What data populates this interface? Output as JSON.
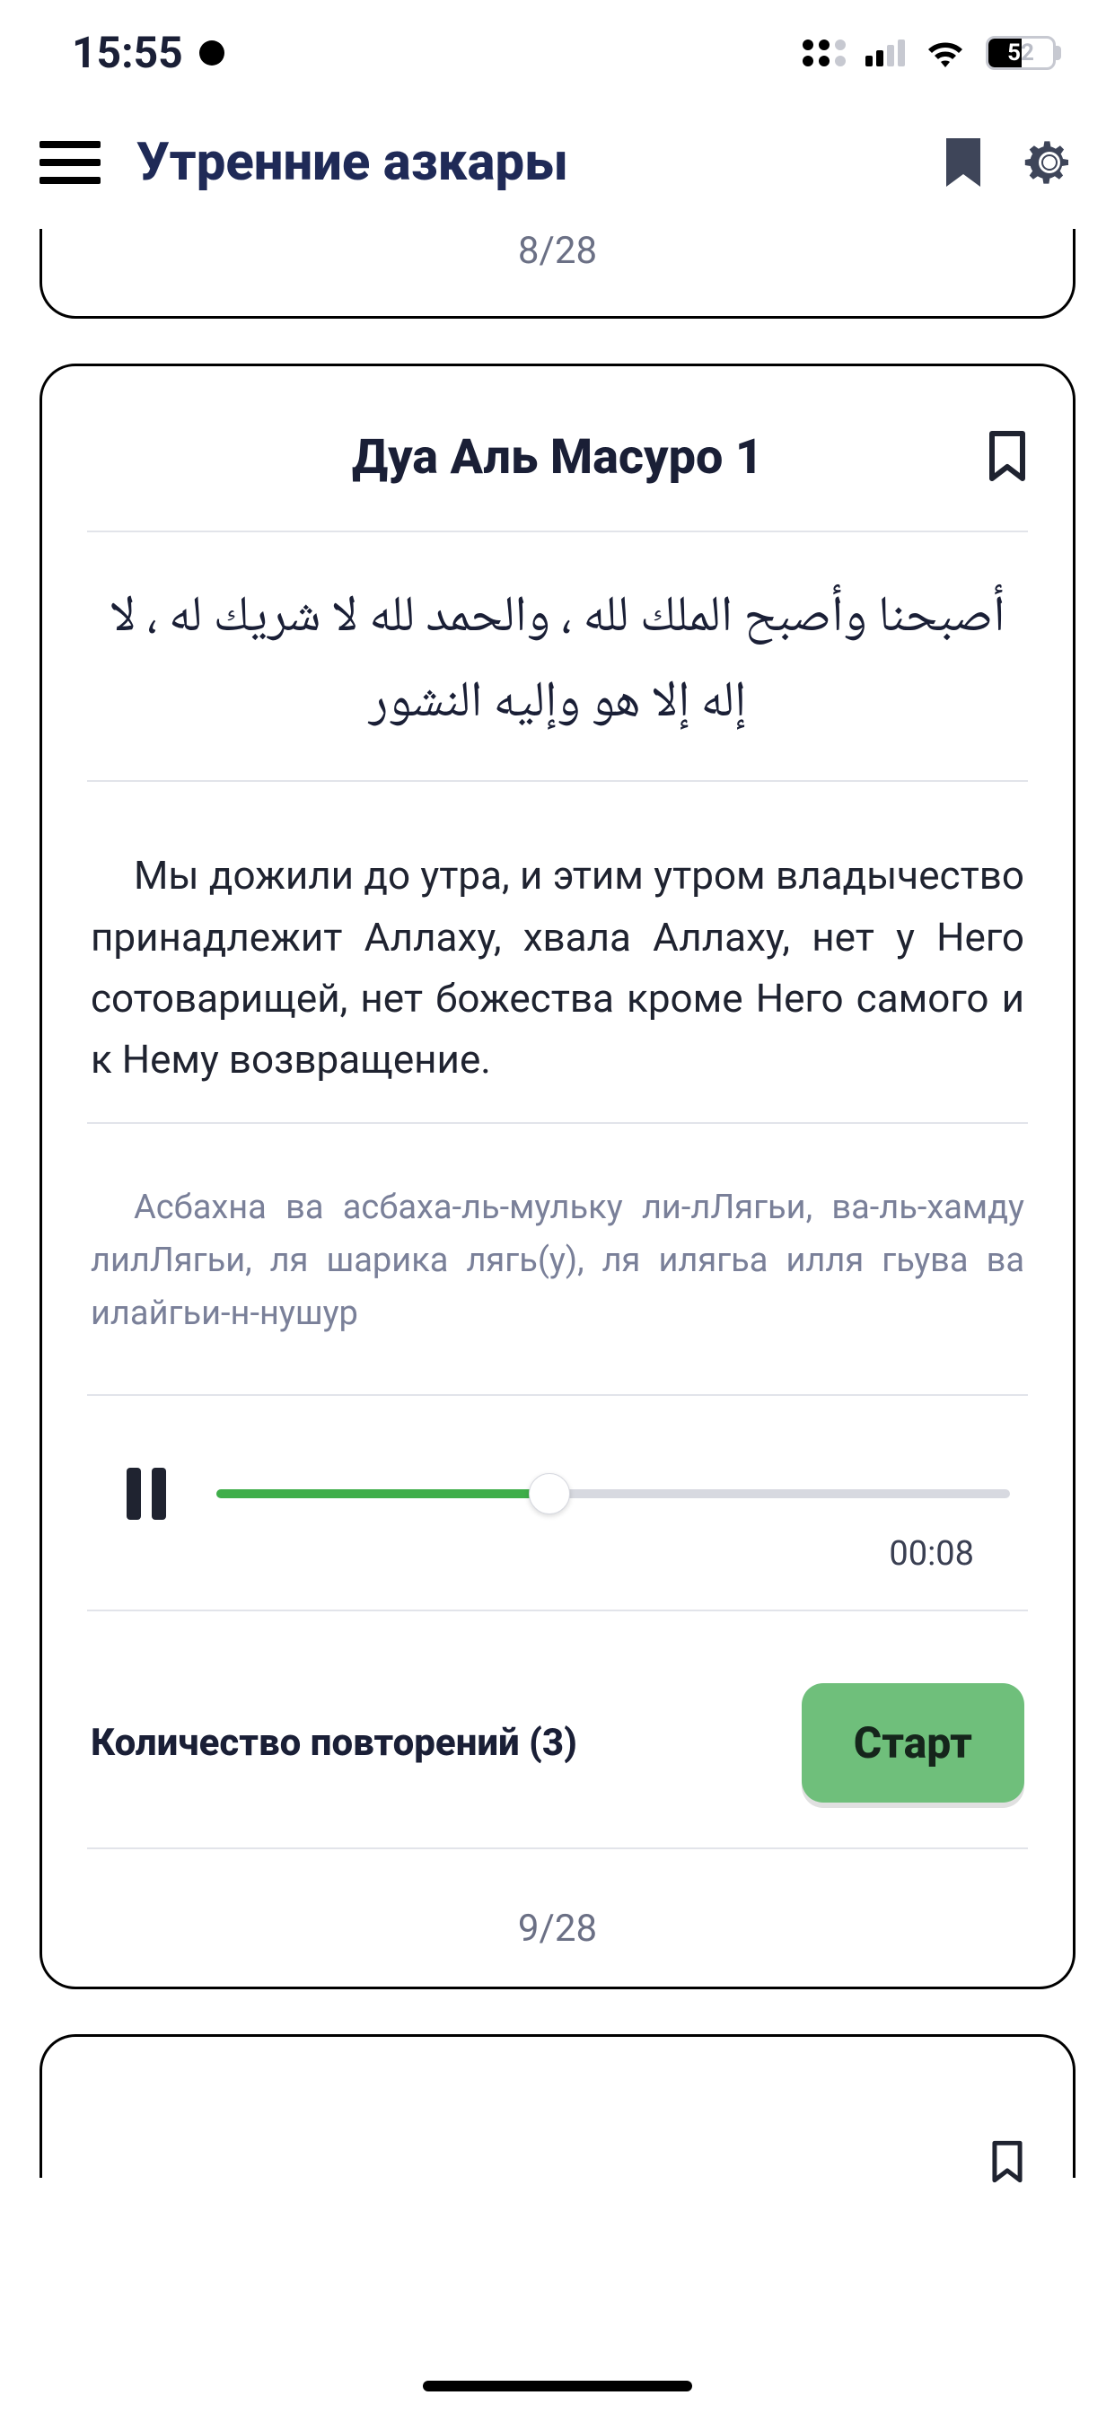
{
  "status": {
    "time": "15:55",
    "battery_text_white": "5",
    "battery_text_gray": "2",
    "battery_percent": 52
  },
  "header": {
    "title": "Утренние азкары"
  },
  "prev_card": {
    "counter": "8/28"
  },
  "card": {
    "title": "Дуа Аль Масуро 1",
    "arabic": "أصبحنا وأصبح الملك لله ، والحمد لله لا شريك له ، لا إله إلا هو وإليه النشور",
    "translation": "Мы дожили до утра, и этим утром владычество принадлежит Аллаху, хвала Аллаху, нет у Него сотоварищей, нет божества кроме Него самого и к Нему возвращение.",
    "translit": "Асбахна ва асбаха-ль-мульку ли-лЛягьи, ва-ль-хамду лилЛягьи, ля шарика лягь(у), ля илягьа илля гьува ва илайгьи-н-нушур",
    "audio_time": "00:08",
    "audio_progress_percent": 42,
    "reps_label": "Количество повторений (3)",
    "start_label": "Старт",
    "counter": "9/28"
  }
}
